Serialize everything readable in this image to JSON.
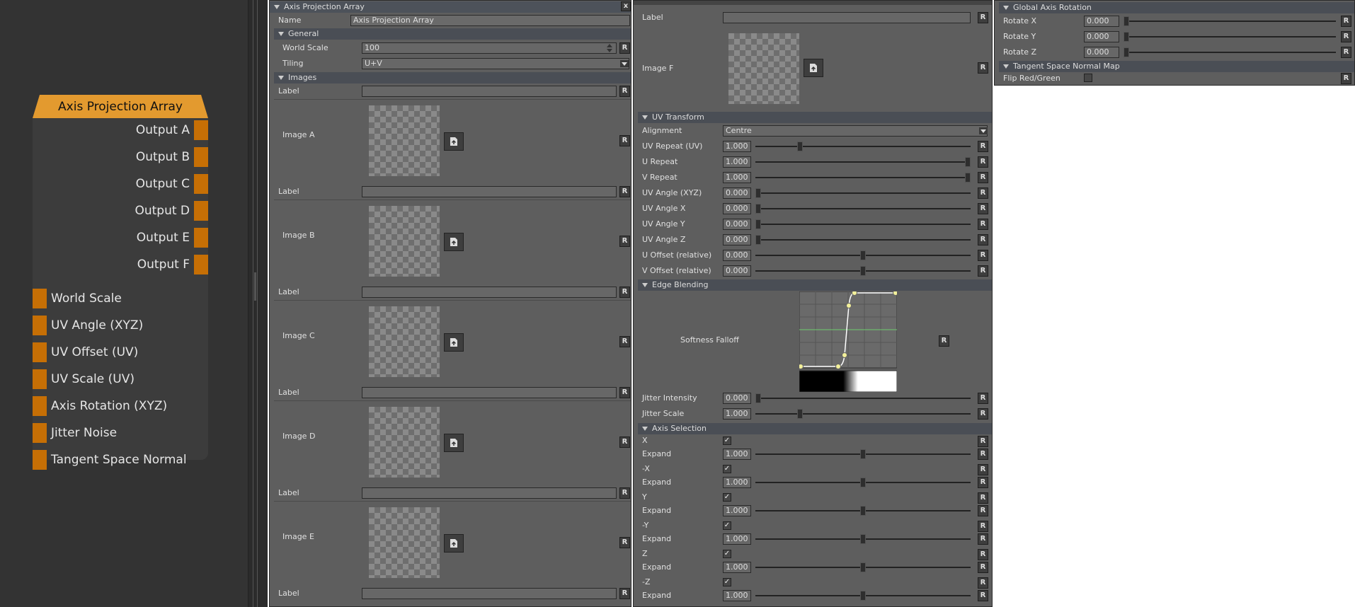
{
  "node": {
    "title": "Axis Projection Array",
    "outputs": [
      "Output A",
      "Output B",
      "Output C",
      "Output D",
      "Output E",
      "Output F"
    ],
    "inputs": [
      "World Scale",
      "UV Angle (XYZ)",
      "UV Offset (UV)",
      "UV Scale (UV)",
      "Axis Rotation (XYZ)",
      "Jitter Noise",
      "Tangent Space Normal"
    ],
    "accent": "#e39a2f",
    "port_color": "#c66f05"
  },
  "panel1": {
    "title": "Axis Projection Array",
    "close": "x",
    "name_label": "Name",
    "name_value": "Axis Projection Array",
    "general_header": "General",
    "world_scale_label": "World Scale",
    "world_scale_value": "100",
    "tiling_label": "Tiling",
    "tiling_value": "U+V",
    "images_header": "Images",
    "label_text": "Label",
    "r": "R",
    "images": [
      "Image A",
      "Image B",
      "Image C",
      "Image D",
      "Image E"
    ]
  },
  "panel2": {
    "label_text": "Label",
    "image_f": "Image F",
    "uv_header": "UV Transform",
    "alignment_label": "Alignment",
    "alignment_value": "Centre",
    "uv_rows": [
      {
        "label": "UV Repeat (UV)",
        "value": "1.000",
        "pos": 0.2
      },
      {
        "label": "U Repeat",
        "value": "1.000",
        "pos": 1.0
      },
      {
        "label": "V Repeat",
        "value": "1.000",
        "pos": 1.0
      },
      {
        "label": "UV Angle (XYZ)",
        "value": "0.000",
        "pos": 0.0
      },
      {
        "label": "UV Angle X",
        "value": "0.000",
        "pos": 0.0
      },
      {
        "label": "UV Angle Y",
        "value": "0.000",
        "pos": 0.0
      },
      {
        "label": "UV Angle Z",
        "value": "0.000",
        "pos": 0.0
      },
      {
        "label": "U Offset (relative)",
        "value": "0.000",
        "pos": 0.5
      },
      {
        "label": "V Offset (relative)",
        "value": "0.000",
        "pos": 0.5
      }
    ],
    "edge_header": "Edge Blending",
    "softness_label": "Softness Falloff",
    "jitter_rows": [
      {
        "label": "Jitter Intensity",
        "value": "0.000",
        "pos": 0.0
      },
      {
        "label": "Jitter Scale",
        "value": "1.000",
        "pos": 0.2
      }
    ],
    "axis_header": "Axis Selection",
    "axis_rows": [
      {
        "label": "X",
        "expand": "Expand",
        "value": "1.000",
        "check": "✓"
      },
      {
        "label": "-X",
        "expand": "Expand",
        "value": "1.000",
        "check": "✓"
      },
      {
        "label": "Y",
        "expand": "Expand",
        "value": "1.000",
        "check": "✓"
      },
      {
        "label": "-Y",
        "expand": "Expand",
        "value": "1.000",
        "check": "✓"
      },
      {
        "label": "Z",
        "expand": "Expand",
        "value": "1.000",
        "check": "✓"
      },
      {
        "label": "-Z",
        "expand": "Expand",
        "value": "1.000",
        "check": "✓"
      }
    ]
  },
  "panel3": {
    "global_header": "Global Axis Rotation",
    "rot_rows": [
      {
        "label": "Rotate X",
        "value": "0.000"
      },
      {
        "label": "Rotate Y",
        "value": "0.000"
      },
      {
        "label": "Rotate Z",
        "value": "0.000"
      }
    ],
    "tangent_header": "Tangent Space Normal Map",
    "flip_label": "Flip Red/Green"
  }
}
